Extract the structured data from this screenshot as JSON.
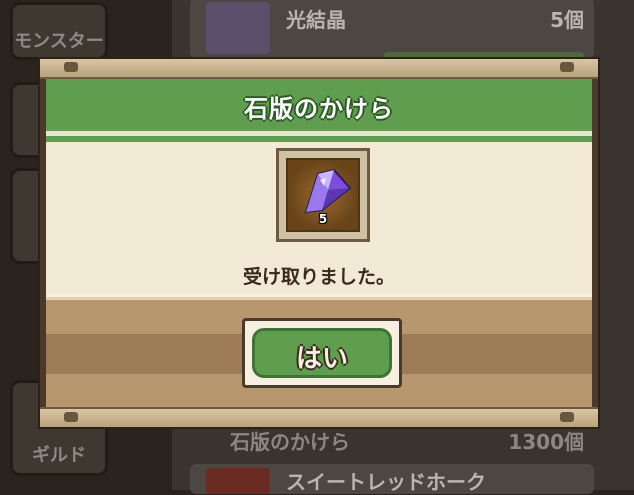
{
  "background": {
    "sidebar": [
      {
        "label": "モンスター"
      },
      {
        "label": ""
      },
      {
        "label": ""
      },
      {
        "label": "ギルド"
      }
    ],
    "list": [
      {
        "name": "光結晶",
        "count": "5個"
      },
      {
        "name": "石版のかけら",
        "count": "1300個"
      },
      {
        "name": "スイートレッドホーク",
        "count": ""
      }
    ]
  },
  "dialog": {
    "title": "石版のかけら",
    "item": {
      "icon": "crystal-icon",
      "count": "5"
    },
    "message": "受け取りました。",
    "confirm_label": "はい"
  },
  "colors": {
    "header_green": "#5e9e4e",
    "content_cream": "#f3ead6",
    "frame_brown": "#4b3a2c"
  }
}
